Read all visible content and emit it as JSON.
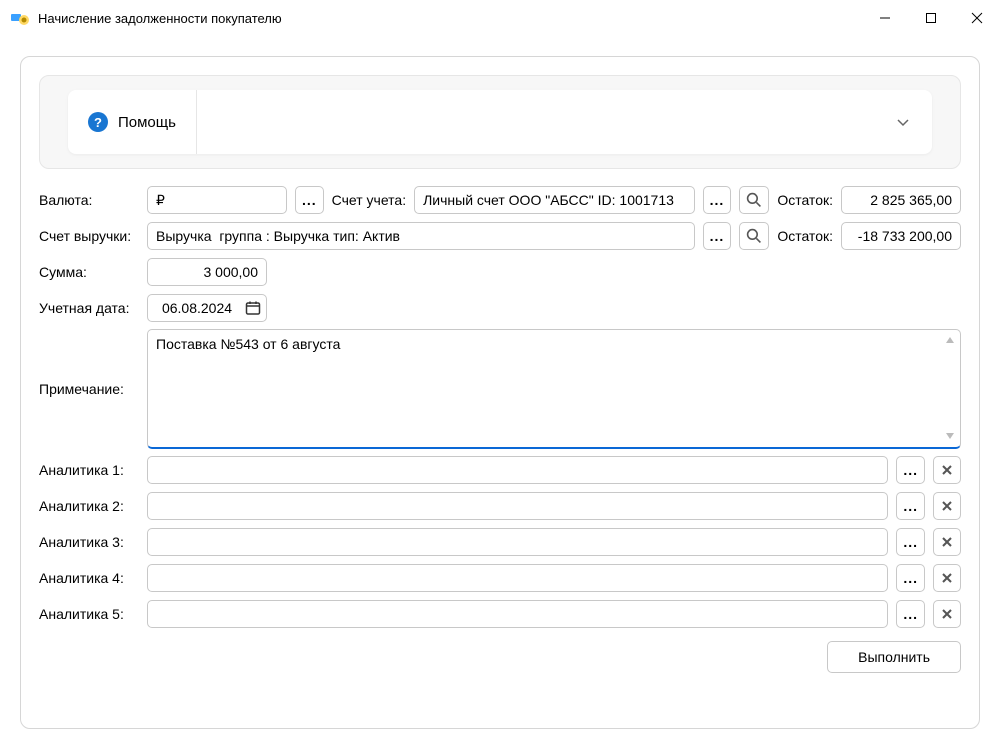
{
  "window": {
    "title": "Начисление задолженности покупателю"
  },
  "help": {
    "label": "Помощь"
  },
  "labels": {
    "currency": "Валюта:",
    "account": "Счет учета:",
    "balance": "Остаток:",
    "revenueAccount": "Счет выручки:",
    "amount": "Сумма:",
    "accDate": "Учетная дата:",
    "note": "Примечание:",
    "analytic1": "Аналитика 1:",
    "analytic2": "Аналитика 2:",
    "analytic3": "Аналитика 3:",
    "analytic4": "Аналитика 4:",
    "analytic5": "Аналитика 5:"
  },
  "values": {
    "currency": "₽",
    "account": "Личный счет ООО \"АБСС\" ID: 1001713",
    "balanceAccount": "2 825 365,00",
    "revenueAccount": "Выручка  группа : Выручка тип: Актив",
    "balanceRevenue": "-18 733 200,00",
    "amount": "3 000,00",
    "accDate": "06.08.2024",
    "note": "Поставка №543 от 6 августа",
    "analytic1": "",
    "analytic2": "",
    "analytic3": "",
    "analytic4": "",
    "analytic5": ""
  },
  "buttons": {
    "ellipsis": "...",
    "clear": "✕",
    "submit": "Выполнить"
  }
}
